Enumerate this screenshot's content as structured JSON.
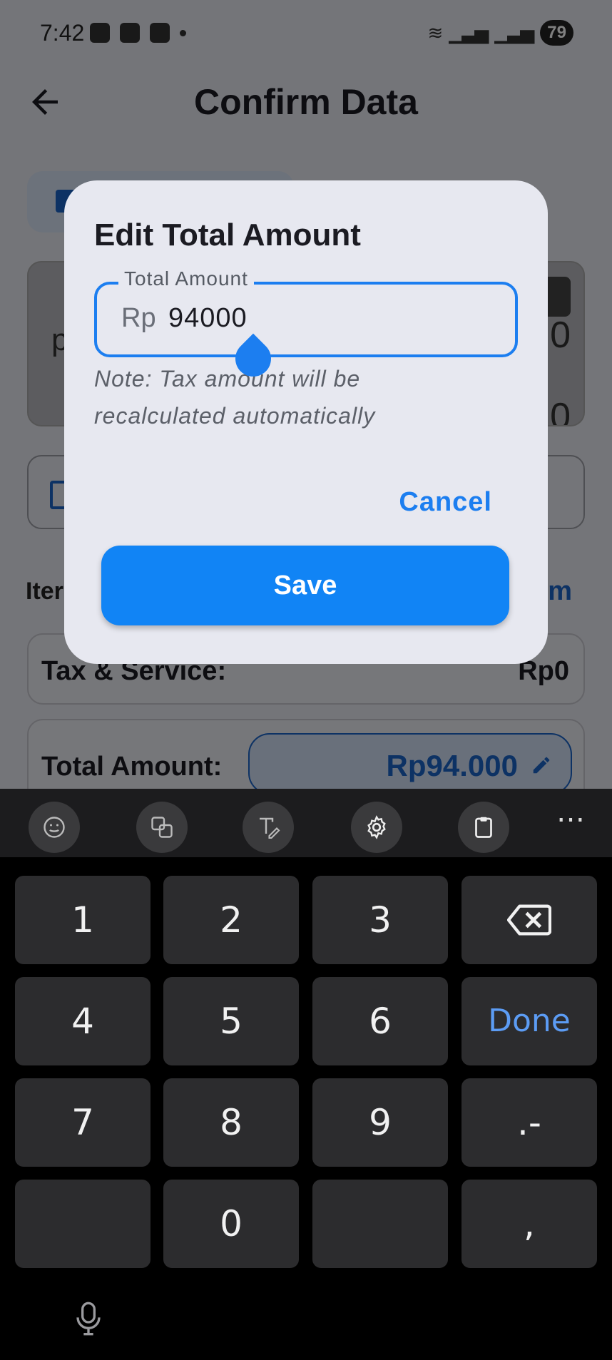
{
  "status_bar": {
    "time": "7:42",
    "battery": "79"
  },
  "header": {
    "title": "Confirm Data"
  },
  "background": {
    "partial_left_text": "p",
    "partial_right_text": "0",
    "items_label": "Iter",
    "add_item_link": "m",
    "tax_label": "Tax & Service:",
    "tax_value": "Rp0",
    "total_label": "Total Amount:",
    "total_value": "Rp94.000"
  },
  "dialog": {
    "title": "Edit Total Amount",
    "field_label": "Total Amount",
    "field_prefix": "Rp",
    "field_value": "94000",
    "note": "Note: Tax amount will be recalculated automatically",
    "cancel_label": "Cancel",
    "save_label": "Save"
  },
  "keyboard": {
    "toolbar": [
      "emoji-icon",
      "translate-icon",
      "handwriting-icon",
      "gear-icon",
      "clipboard-icon",
      "more-icon"
    ],
    "more_label": "⋯",
    "keys": {
      "k1": "1",
      "k2": "2",
      "k3": "3",
      "k4": "4",
      "k5": "5",
      "k6": "6",
      "done": "Done",
      "k7": "7",
      "k8": "8",
      "k9": "9",
      "dotdash": ".-",
      "k0": "0",
      "comma": ","
    }
  },
  "colors": {
    "accent": "#1C7EF0",
    "save_button": "#1184F5",
    "done_key": "#5C9CF4"
  }
}
